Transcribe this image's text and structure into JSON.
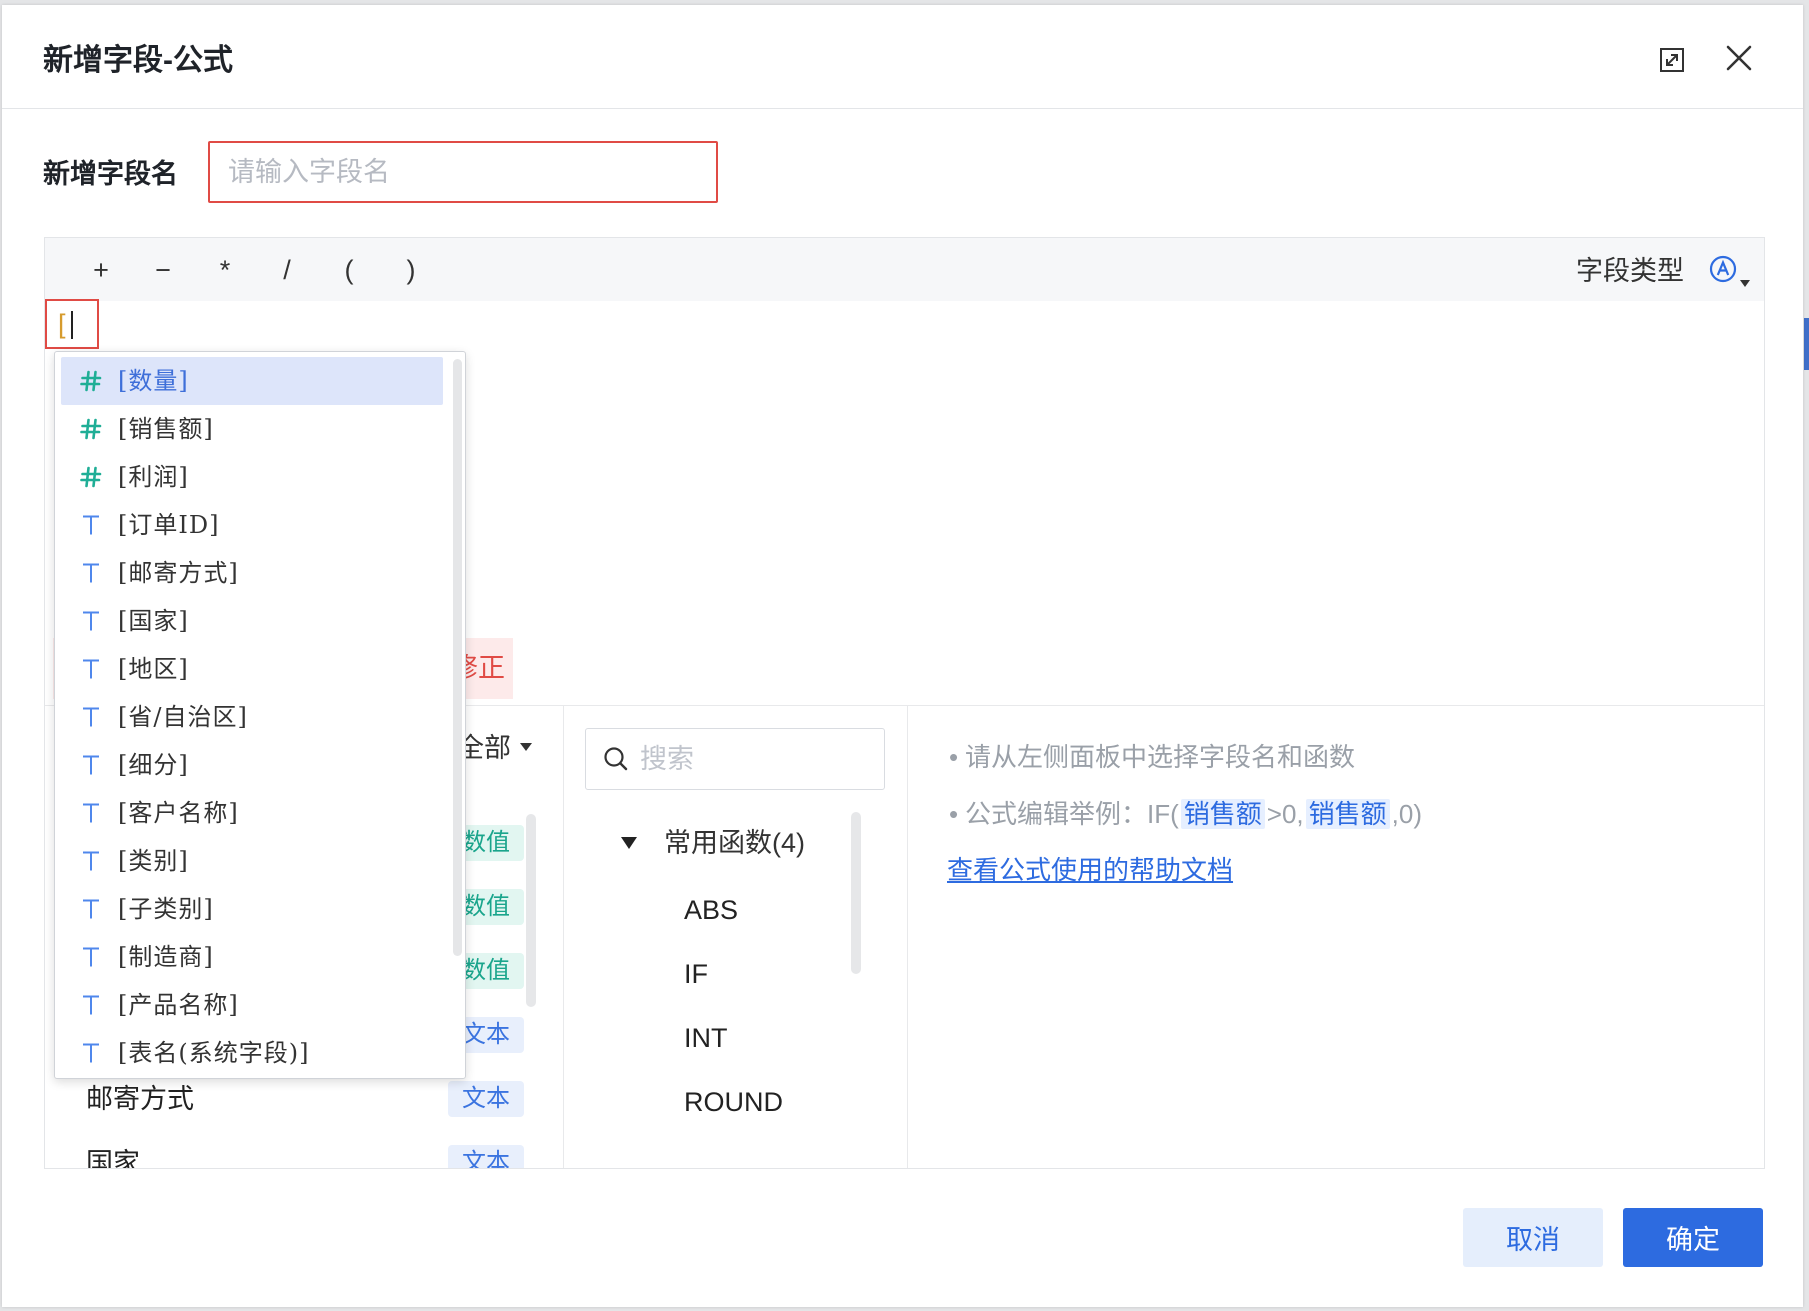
{
  "dialog": {
    "title": "新增字段-公式"
  },
  "field_name": {
    "label": "新增字段名",
    "placeholder": "请输入字段名",
    "value": ""
  },
  "toolbar": {
    "operators": [
      "+",
      "−",
      "*",
      "/",
      "(",
      ")"
    ],
    "field_type_label": "字段类型",
    "field_type_icon": "circled-a-icon"
  },
  "editor": {
    "content": "[",
    "error_text": "修正"
  },
  "autocomplete": {
    "selected_index": 0,
    "items": [
      {
        "icon": "number-icon",
        "label": "[数量]"
      },
      {
        "icon": "number-icon",
        "label": "[销售额]"
      },
      {
        "icon": "number-icon",
        "label": "[利润]"
      },
      {
        "icon": "text-icon",
        "label": "[订单ID]"
      },
      {
        "icon": "text-icon",
        "label": "[邮寄方式]"
      },
      {
        "icon": "text-icon",
        "label": "[国家]"
      },
      {
        "icon": "text-icon",
        "label": "[地区]"
      },
      {
        "icon": "text-icon",
        "label": "[省/自治区]"
      },
      {
        "icon": "text-icon",
        "label": "[细分]"
      },
      {
        "icon": "text-icon",
        "label": "[客户名称]"
      },
      {
        "icon": "text-icon",
        "label": "[类别]"
      },
      {
        "icon": "text-icon",
        "label": "[子类别]"
      },
      {
        "icon": "text-icon",
        "label": "[制造商]"
      },
      {
        "icon": "text-icon",
        "label": "[产品名称]"
      },
      {
        "icon": "text-icon",
        "label": "[表名(系统字段)]"
      }
    ]
  },
  "field_panel": {
    "filter_label": "全部",
    "fields": [
      {
        "name": "",
        "type": "数值"
      },
      {
        "name": "",
        "type": "数值"
      },
      {
        "name": "",
        "type": "数值"
      },
      {
        "name": "",
        "type": "文本"
      },
      {
        "name": "邮寄方式",
        "type": "文本"
      },
      {
        "name": "国家",
        "type": "文本"
      }
    ],
    "tag_colors": {
      "数值": {
        "text": "#1aa58c",
        "bg": "#e2f6f1"
      },
      "文本": {
        "text": "#3b74e0",
        "bg": "#e8effc"
      }
    }
  },
  "function_panel": {
    "search_placeholder": "搜索",
    "group_label": "常用函数(4)",
    "functions": [
      "ABS",
      "IF",
      "INT",
      "ROUND"
    ]
  },
  "help_panel": {
    "hint": "请从左侧面板中选择字段名和函数",
    "example": {
      "prefix": "公式编辑举例：IF(",
      "field_1": "销售额",
      "middle": ">0,",
      "field_2": "销售额",
      "suffix": ",0)"
    },
    "doc_link": "查看公式使用的帮助文档"
  },
  "footer": {
    "cancel_label": "取消",
    "confirm_label": "确定"
  },
  "icons": {
    "expand": "expand-icon",
    "close": "close-icon",
    "search": "search-icon"
  },
  "colors": {
    "accent": "#2d6be0",
    "error": "#e04b45",
    "number_icon": "#1fae96",
    "text_icon": "#4f87ec",
    "selected_row": "#dde5fa",
    "bracket": "#d69b2d"
  }
}
